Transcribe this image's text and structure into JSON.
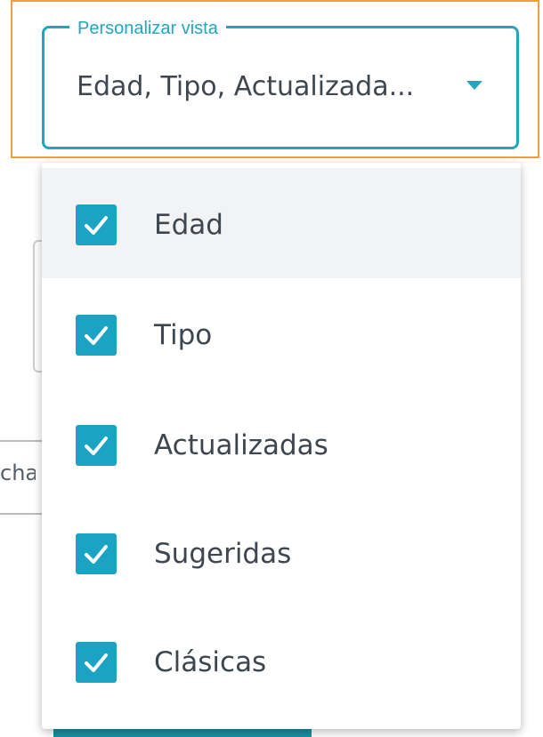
{
  "background": {
    "fragment_text": "cha"
  },
  "select": {
    "label": "Personalizar vista",
    "value": "Edad, Tipo, Actualizada...",
    "caret_icon": "caret-down-icon"
  },
  "colors": {
    "accent": "#21a6bf",
    "checkbox": "#1aa3c2",
    "focus_outline": "#f2a033",
    "text": "#3e4650",
    "hover_row": "#f2f3f4"
  },
  "menu": {
    "items": [
      {
        "label": "Edad",
        "checked": true,
        "hovered": true
      },
      {
        "label": "Tipo",
        "checked": true,
        "hovered": false
      },
      {
        "label": "Actualizadas",
        "checked": true,
        "hovered": false
      },
      {
        "label": "Sugeridas",
        "checked": true,
        "hovered": false
      },
      {
        "label": "Clásicas",
        "checked": true,
        "hovered": false
      }
    ],
    "check_icon": "checkmark-icon"
  }
}
